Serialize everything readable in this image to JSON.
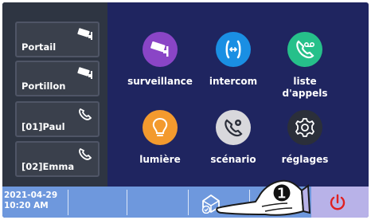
{
  "contacts": [
    {
      "label": "Portail",
      "icon": "camera-icon"
    },
    {
      "label": "Portillon",
      "icon": "camera-icon"
    },
    {
      "label": "[01]Paul",
      "icon": "phone-icon"
    },
    {
      "label": "[02]Emma",
      "icon": "phone-icon"
    }
  ],
  "apps": [
    {
      "label": "surveillance",
      "icon": "surveillance-camera-icon",
      "color": "#8a45c6"
    },
    {
      "label": "intercom",
      "icon": "intercom-icon",
      "color": "#1a8fe3"
    },
    {
      "label": "liste\nd'appels",
      "label_line1": "liste",
      "label_line2": "d'appels",
      "icon": "voicemail-phone-icon",
      "color": "#26c08a"
    },
    {
      "label": "lumière",
      "icon": "light-bulb-icon",
      "color": "#f39a2e"
    },
    {
      "label": "scénario",
      "icon": "scenario-phone-gear-icon",
      "color": "#d8d8dc"
    },
    {
      "label": "réglages",
      "icon": "settings-gear-icon",
      "color": "#2b2f3a"
    }
  ],
  "bottombar": {
    "date": "2021-04-29",
    "time": "10:20 AM",
    "scene_icon": "home-scene-icon",
    "power_icon": "power-icon",
    "callout_number": "❶",
    "pointer_icon": "pointing-hand-icon"
  },
  "colors": {
    "screen_bg": "#1f2560",
    "bottombar_bg": "#6e98dd",
    "power_bg": "#b8b2e8",
    "power_icon": "#e02020"
  }
}
